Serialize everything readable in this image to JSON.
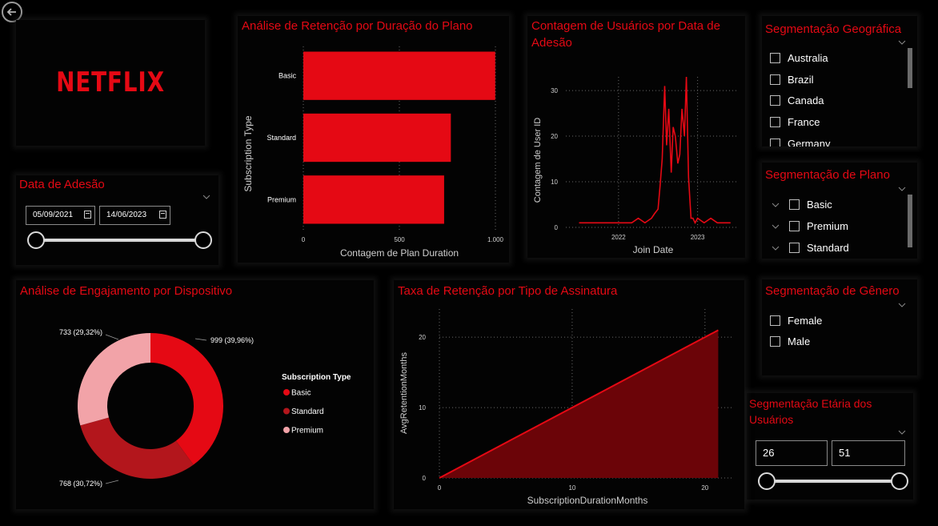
{
  "nav": {
    "back_icon": "back-arrow-icon"
  },
  "logo": {
    "text": "NETFLIX",
    "color": "#e50914"
  },
  "join_date": {
    "title": "Data de Adesão",
    "start": "05/09/2021",
    "end": "14/06/2023",
    "range_selected": [
      0,
      1
    ]
  },
  "retention_by_plan": {
    "title": "Análise de Retenção por Duração do Plano",
    "chart_data": {
      "type": "bar",
      "orientation": "horizontal",
      "categories": [
        "Basic",
        "Standard",
        "Premium"
      ],
      "values": [
        999,
        768,
        733
      ],
      "xlabel": "Contagem de Plan Duration",
      "ylabel": "Subscription Type",
      "xlim": [
        0,
        1000
      ],
      "xticks": [
        "0",
        "500",
        "1.000"
      ],
      "grid": true,
      "color": "#e50914"
    }
  },
  "users_by_date": {
    "title": "Contagem de Usuários por Data de Adesão",
    "chart_data": {
      "type": "line",
      "xlabel": "Join Date",
      "ylabel": "Contagem de User ID",
      "xlim": [
        "2021-05",
        "2023-07"
      ],
      "ylim": [
        0,
        33
      ],
      "yticks": [
        0,
        10,
        20,
        30
      ],
      "xticks": [
        "2022",
        "2023"
      ],
      "grid": true,
      "color": "#e50914",
      "series": [
        {
          "x": [
            "2021-07",
            "2021-10",
            "2022-01",
            "2022-03",
            "2022-04",
            "2022-05",
            "2022-06",
            "2022-06-15",
            "2022-07",
            "2022-07-10",
            "2022-07-20",
            "2022-08",
            "2022-08-10",
            "2022-08-20",
            "2022-09",
            "2022-09-10",
            "2022-09-20",
            "2022-10",
            "2022-10-10",
            "2022-10-20",
            "2022-11",
            "2022-11-10",
            "2022-11-20",
            "2022-12",
            "2022-12-10",
            "2022-12-20",
            "2023-01",
            "2023-02",
            "2023-03",
            "2023-04",
            "2023-06"
          ],
          "values": [
            1,
            1,
            1,
            1,
            2,
            1,
            2,
            3,
            4,
            9,
            15,
            31,
            18,
            26,
            12,
            22,
            20,
            14,
            16,
            26,
            20,
            33,
            11,
            2,
            2,
            1,
            2,
            1,
            2,
            1,
            1
          ]
        }
      ]
    }
  },
  "geo_slicer": {
    "title": "Segmentação Geográfica",
    "items": [
      "Australia",
      "Brazil",
      "Canada",
      "France",
      "Germany"
    ]
  },
  "plan_slicer": {
    "title": "Segmentação de Plano",
    "items": [
      "Basic",
      "Premium",
      "Standard"
    ]
  },
  "gender_slicer": {
    "title": "Segmentação de Gênero",
    "items": [
      "Female",
      "Male"
    ]
  },
  "age_slicer": {
    "title": "Segmentação Etária dos Usuários",
    "min": "26",
    "max": "51",
    "range_selected": [
      0,
      1
    ]
  },
  "device_engagement": {
    "title": "Análise de Engajamento por Dispositivo",
    "chart_data": {
      "type": "pie",
      "donut": true,
      "legend_title": "Subscription Type",
      "legend_position": "right",
      "labels": [
        "Basic",
        "Standard",
        "Premium"
      ],
      "values": [
        999,
        768,
        733
      ],
      "data_labels": [
        "999 (39,96%)",
        "768 (30,72%)",
        "733 (29,32%)"
      ],
      "colors": [
        "#e50914",
        "#b3161c",
        "#f2a3a8"
      ]
    }
  },
  "retention_rate": {
    "title": "Taxa de Retenção por Tipo de Assinatura",
    "chart_data": {
      "type": "area",
      "xlabel": "SubscriptionDurationMonths",
      "ylabel": "AvgRetentionMonths",
      "x": [
        0,
        21
      ],
      "values": [
        0,
        21
      ],
      "xlim": [
        0,
        22
      ],
      "ylim": [
        0,
        24
      ],
      "xticks": [
        0,
        10,
        20
      ],
      "yticks": [
        0,
        10,
        20
      ],
      "grid": true,
      "color": "#e50914"
    }
  }
}
